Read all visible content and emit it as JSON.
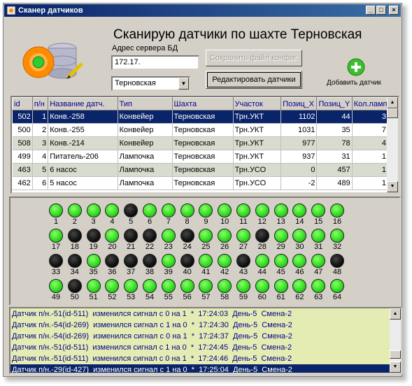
{
  "window": {
    "title": "Сканер датчиков",
    "minimize": "_",
    "maximize": "□",
    "close": "×"
  },
  "heading": "Сканирую датчики по шахте Терновская",
  "server": {
    "label": "Адрес сервера БД",
    "value": "172.17."
  },
  "mine_select": {
    "value": "Терновская"
  },
  "buttons": {
    "save_config": "Сохранить файл конфиг.",
    "edit_sensors": "Редактировать датчики",
    "add_sensor": "Добавить датчик"
  },
  "table": {
    "columns": [
      "id",
      "п/н",
      "Название датч.",
      "Тип",
      "Шахта",
      "Участок",
      "Позиц_X",
      "Позиц_Y",
      "Кол.ламп."
    ],
    "rows": [
      {
        "id": "502",
        "pn": "1",
        "name": "Конв.-258",
        "type": "Конвейер",
        "mine": "Терновская",
        "section": "Трн.УКТ",
        "x": "1102",
        "y": "44",
        "lamps": "3",
        "selected": true
      },
      {
        "id": "500",
        "pn": "2",
        "name": "Конв.-255",
        "type": "Конвейер",
        "mine": "Терновская",
        "section": "Трн.УКТ",
        "x": "1031",
        "y": "35",
        "lamps": "7"
      },
      {
        "id": "508",
        "pn": "3",
        "name": "Конв.-214",
        "type": "Конвейер",
        "mine": "Терновская",
        "section": "Трн.УКТ",
        "x": "977",
        "y": "78",
        "lamps": "4"
      },
      {
        "id": "499",
        "pn": "4",
        "name": "Питатель-206",
        "type": "Лампочка",
        "mine": "Терновская",
        "section": "Трн.УКТ",
        "x": "937",
        "y": "31",
        "lamps": "1"
      },
      {
        "id": "463",
        "pn": "5",
        "name": "6 насос",
        "type": "Лампочка",
        "mine": "Терновская",
        "section": "Трн.УСО",
        "x": "0",
        "y": "457",
        "lamps": "1"
      },
      {
        "id": "462",
        "pn": "6",
        "name": "5 насос",
        "type": "Лампочка",
        "mine": "Терновская",
        "section": "Трн.УСО",
        "x": "-2",
        "y": "489",
        "lamps": "1"
      }
    ]
  },
  "leds": {
    "states": [
      "on",
      "on",
      "on",
      "on",
      "off",
      "on",
      "on",
      "on",
      "on",
      "on",
      "on",
      "on",
      "on",
      "on",
      "on",
      "on",
      "on",
      "off",
      "off",
      "on",
      "off",
      "off",
      "on",
      "off",
      "on",
      "on",
      "on",
      "off",
      "on",
      "on",
      "on",
      "on",
      "off",
      "off",
      "on",
      "off",
      "off",
      "off",
      "on",
      "off",
      "on",
      "on",
      "off",
      "on",
      "on",
      "on",
      "on",
      "off",
      "on",
      "off",
      "on",
      "on",
      "on",
      "on",
      "on",
      "on",
      "on",
      "on",
      "on",
      "on",
      "on",
      "on",
      "on",
      "on"
    ],
    "labels": [
      "1",
      "2",
      "3",
      "4",
      "5",
      "6",
      "7",
      "8",
      "9",
      "10",
      "11",
      "12",
      "13",
      "14",
      "15",
      "16",
      "17",
      "18",
      "19",
      "20",
      "21",
      "22",
      "23",
      "24",
      "25",
      "26",
      "27",
      "28",
      "29",
      "30",
      "31",
      "32",
      "33",
      "34",
      "35",
      "36",
      "37",
      "38",
      "39",
      "40",
      "41",
      "42",
      "43",
      "44",
      "45",
      "46",
      "47",
      "48",
      "49",
      "50",
      "51",
      "52",
      "53",
      "54",
      "55",
      "56",
      "57",
      "58",
      "59",
      "60",
      "61",
      "62",
      "63",
      "64"
    ]
  },
  "log": [
    {
      "text": "Датчик п/н.-51(id-511)  изменился сигнал с 0 на 1  *  17:24:03  День-5  Смена-2"
    },
    {
      "text": "Датчик п/н.-54(id-269)  изменился сигнал с 1 на 0  *  17:24:30  День-5  Смена-2"
    },
    {
      "text": "Датчик п/н.-54(id-269)  изменился сигнал с 0 на 1  *  17:24:37  День-5  Смена-2"
    },
    {
      "text": "Датчик п/н.-51(id-511)  изменился сигнал с 1 на 0  *  17:24:45  День-5  Смена-2"
    },
    {
      "text": "Датчик п/н.-51(id-511)  изменился сигнал с 0 на 1  *  17:24:46  День-5  Смена-2"
    },
    {
      "text": "Датчик п/н.-29(id-427)  изменился сигнал с 1 на 0  *  17:25:04  День-5  Смена-2",
      "selected": true
    }
  ]
}
